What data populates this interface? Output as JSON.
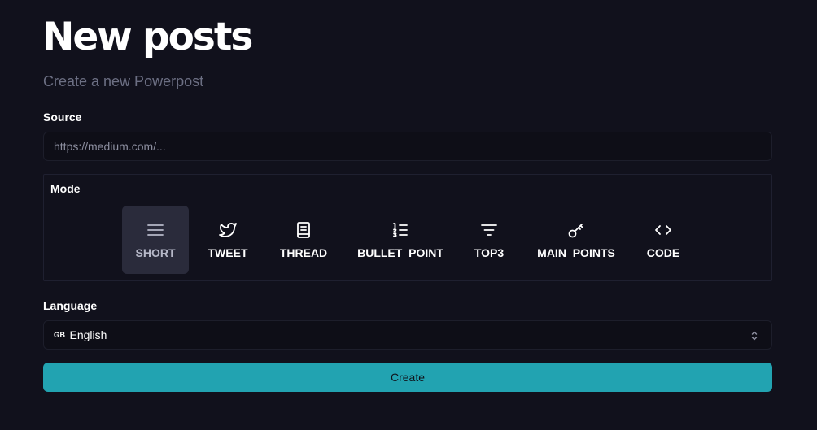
{
  "header": {
    "title": "New posts",
    "subtitle": "Create a new Powerpost"
  },
  "source": {
    "label": "Source",
    "placeholder": "https://medium.com/...",
    "value": ""
  },
  "mode": {
    "label": "Mode",
    "selected": "SHORT",
    "options": [
      {
        "label": "SHORT",
        "icon": "menu-lines-icon"
      },
      {
        "label": "TWEET",
        "icon": "twitter-bird-icon"
      },
      {
        "label": "THREAD",
        "icon": "notebook-icon"
      },
      {
        "label": "BULLET_POINT",
        "icon": "numbered-list-icon"
      },
      {
        "label": "TOP3",
        "icon": "filter-icon"
      },
      {
        "label": "MAIN_POINTS",
        "icon": "key-icon"
      },
      {
        "label": "CODE",
        "icon": "code-brackets-icon"
      }
    ]
  },
  "language": {
    "label": "Language",
    "flag": "GB",
    "value": "English",
    "icon": "selector-chevrons-icon"
  },
  "create_button": {
    "label": "Create"
  },
  "colors": {
    "background": "#11111c",
    "accent": "#22a3b1",
    "active_tile": "#2a2b3b"
  }
}
